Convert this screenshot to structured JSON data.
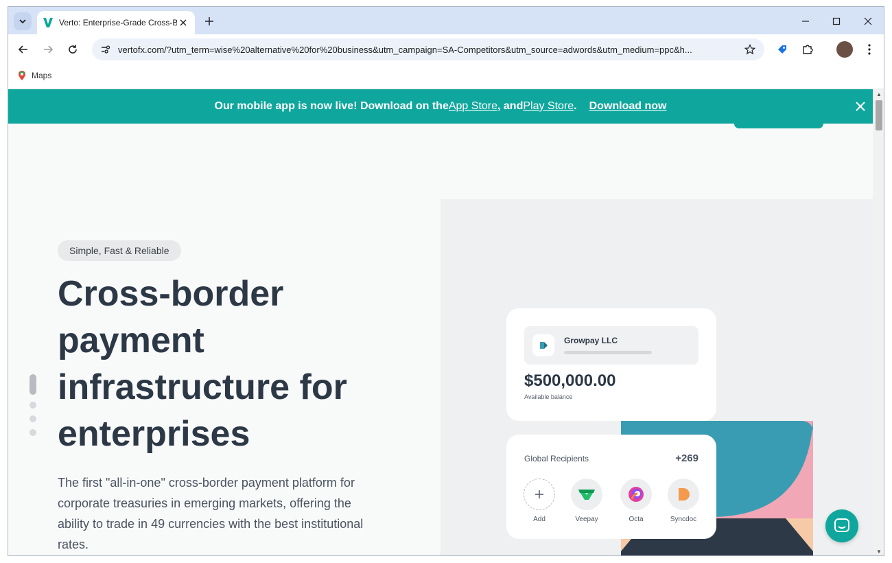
{
  "browser": {
    "tab_title": "Verto: Enterprise-Grade Cross-B",
    "url": "vertofx.com/?utm_term=wise%20alternative%20for%20business&utm_campaign=SA-Competitors&utm_source=adwords&utm_medium=ppc&h...",
    "bookmarks": [
      {
        "label": "Maps"
      }
    ]
  },
  "banner": {
    "lead": "Our mobile app is now live! Download on the ",
    "app_store": "App Store",
    "middle": ", and ",
    "play_store": "Play Store",
    "period": ".",
    "download": "Download now"
  },
  "hero": {
    "pill": "Simple, Fast & Reliable",
    "headline": "Cross-border payment infrastructure for enterprises",
    "subtext": "The first \"all-in-one\" cross-border payment platform for corporate treasuries in emerging markets, offering the ability to trade in 49 currencies with the best institutional rates."
  },
  "balance_card": {
    "company": "Growpay LLC",
    "amount": "$500,000.00",
    "label": "Available balance"
  },
  "recipients_card": {
    "title": "Global Recipients",
    "count": "+269",
    "items": [
      {
        "label": "Add",
        "icon": "plus-icon"
      },
      {
        "label": "Veepay",
        "icon": "veepay-logo"
      },
      {
        "label": "Octa",
        "icon": "octa-logo"
      },
      {
        "label": "Syncdoc",
        "icon": "syncdoc-logo"
      }
    ]
  },
  "colors": {
    "brand_teal": "#0fa79d",
    "headline": "#2d3846",
    "chart_teal": "#3a9cb2",
    "chart_pink": "#f1a7b5"
  }
}
